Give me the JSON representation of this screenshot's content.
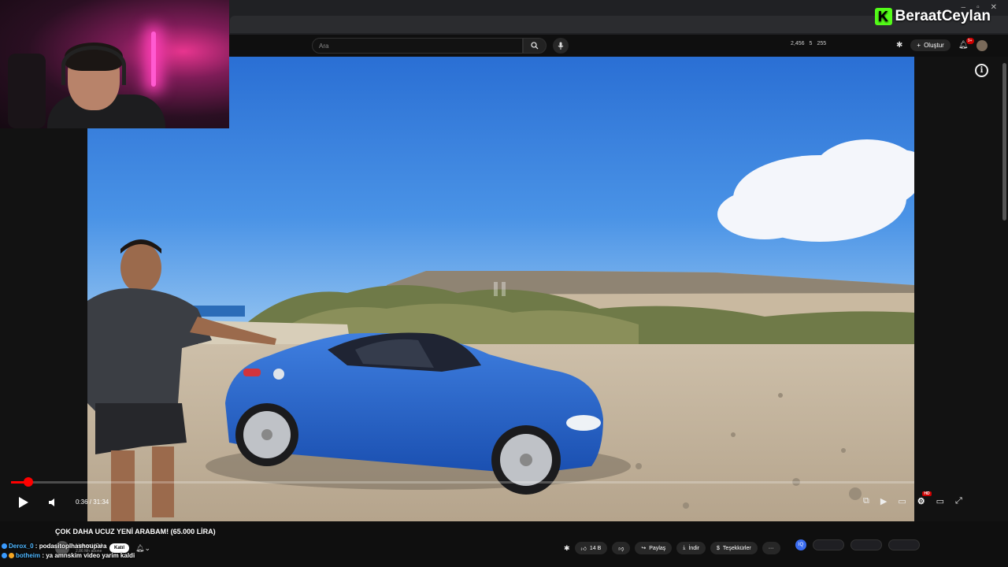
{
  "brand": {
    "logo_letter": "K",
    "streamer_name": "BeraatCeylan"
  },
  "window": {
    "minimize": "–",
    "maximize": "▫",
    "close": "✕"
  },
  "header": {
    "search_placeholder": "Ara",
    "stats": [
      "2,456",
      "5",
      "255"
    ],
    "create_label": "Oluştur",
    "notification_badge": "9+"
  },
  "player": {
    "current_time": "0:36",
    "duration": "31:34",
    "time_display": "0:36 / 31:34",
    "progress_fraction": 0.019,
    "quality_badge": "HD"
  },
  "video_info": {
    "title": "ÇOK DAHA UCUZ YENİ ARABAM! (65.000 LİRA)",
    "channel_name": "HasanUCA",
    "subscribers": "2,86 Mn abone",
    "join_label": "Katıl"
  },
  "actions": {
    "like_count": "14 B",
    "share_label": "Paylaş",
    "download_label": "İndir",
    "thanks_label": "Teşekkürler",
    "more_label": "···"
  },
  "chat": [
    {
      "user": "Derox_0",
      "message": "podasitoplhashoupara"
    },
    {
      "user": "botheim",
      "message": "ya amnskim video yarim kaldi"
    }
  ],
  "colors": {
    "accent_red": "#ff0000",
    "kick_green": "#53fc18",
    "bg": "#0f0f0f"
  }
}
